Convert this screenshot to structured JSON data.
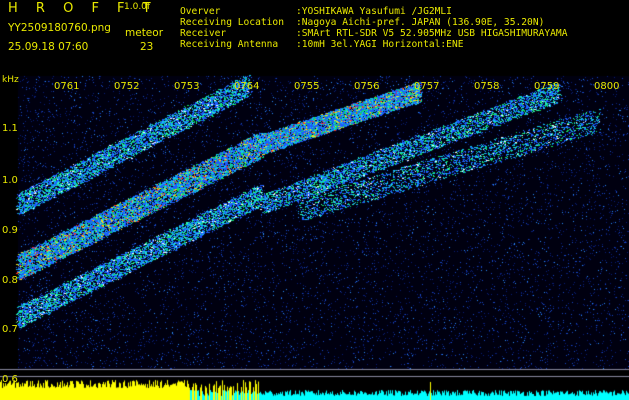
{
  "app": {
    "title": "H R O F F T",
    "version": "1.0.0f"
  },
  "file": {
    "name": "YY2509180760.png",
    "datetime": "25.09.18 07:60"
  },
  "meteor": {
    "label": "meteor",
    "count": "23"
  },
  "info": [
    {
      "key": "Overver",
      "value": ":YOSHIKAWA Yasufumi /JG2MLI"
    },
    {
      "key": "Receiving Location",
      "value": ":Nagoya Aichi-pref. JAPAN (136.90E, 35.20N)"
    },
    {
      "key": "Receiver",
      "value": ":SMArt RTL-SDR V5 52.905MHz USB HIGASHIMURAYAMA"
    },
    {
      "key": "Receiving Antenna",
      "value": ":10mH 3el.YAGI Horizontal:ENE"
    }
  ],
  "axis": {
    "unit": "kHz",
    "y_ticks": [
      "1.1",
      "1.0",
      "0.9",
      "0.8",
      "0.7",
      "0.6"
    ],
    "x_ticks": [
      "0761",
      "0752",
      "0753",
      "0764",
      "0755",
      "0756",
      "0757",
      "0758",
      "0759",
      "0800"
    ]
  },
  "colors": {
    "text": "#e8e800",
    "background": "#000000",
    "bar_primary": "#ffff00",
    "bar_secondary": "#00ffff"
  }
}
